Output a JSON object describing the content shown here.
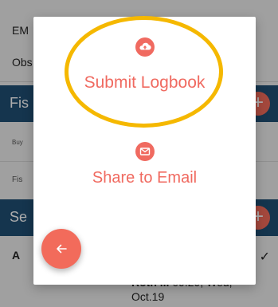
{
  "background": {
    "em_label": "EM",
    "obs_label": "Obs",
    "fish_band": "Fis",
    "buy_label": "Buy",
    "fish_row": "Fis",
    "se_band": "Se",
    "a_label": "A",
    "bottom_text_bold": "Roth ... ",
    "bottom_text_time": "09.29, Wed,",
    "bottom_text_date": "Oct.19",
    "plus_symbol": "+",
    "check_symbol": "✓"
  },
  "dialog": {
    "submit": {
      "label": "Submit Logbook",
      "icon": "cloud-upload-icon"
    },
    "share": {
      "label": "Share to Email",
      "icon": "mail-icon"
    }
  },
  "fab": {
    "icon": "arrow-left-icon"
  },
  "colors": {
    "accent": "#f06a60",
    "highlight": "#f5b800",
    "band": "#1f4e73"
  }
}
